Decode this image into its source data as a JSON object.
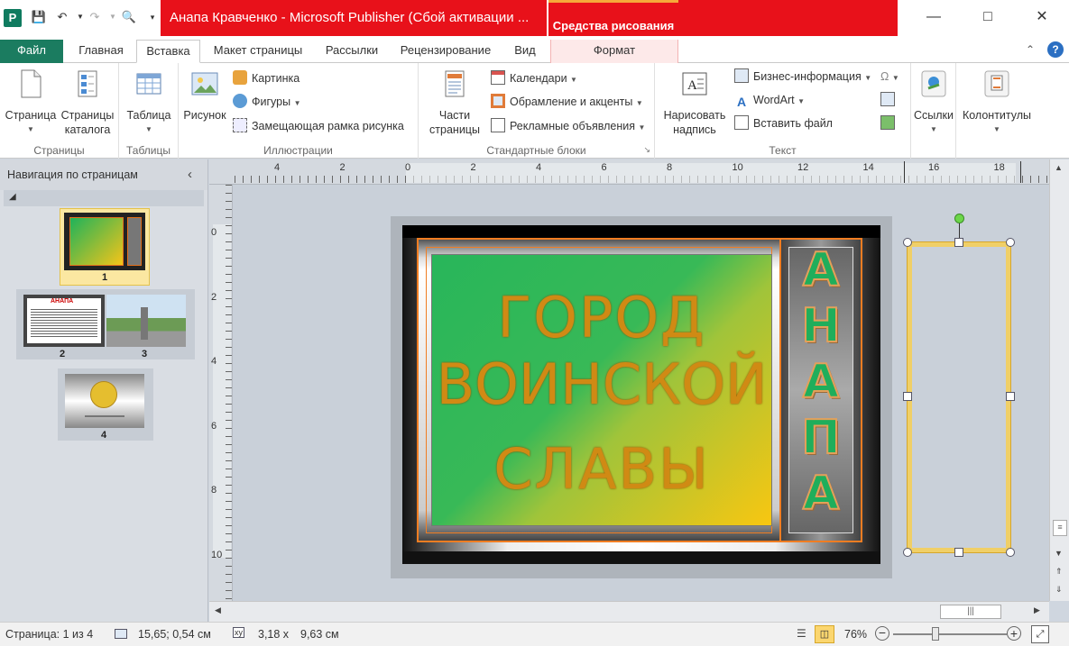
{
  "window": {
    "title": "Анапа Кравченко  -  Microsoft Publisher (Сбой активации ...",
    "context_tools": "Средства рисования",
    "app_icon": "publisher-icon"
  },
  "tabs": {
    "file": "Файл",
    "items": [
      "Главная",
      "Вставка",
      "Макет страницы",
      "Рассылки",
      "Рецензирование",
      "Вид"
    ],
    "context_tab": "Формат",
    "active": "Вставка"
  },
  "ribbon": {
    "pages": {
      "label": "Страницы",
      "page_btn": "Страница",
      "catalog_btn_1": "Страницы",
      "catalog_btn_2": "каталога"
    },
    "tables": {
      "label": "Таблицы",
      "table_btn": "Таблица"
    },
    "illustrations": {
      "label": "Иллюстрации",
      "picture_btn": "Рисунок",
      "clipart": "Картинка",
      "shapes": "Фигуры",
      "placeholder": "Замещающая рамка рисунка"
    },
    "blocks": {
      "label": "Стандартные блоки",
      "parts_1": "Части",
      "parts_2": "страницы",
      "calendars": "Календари",
      "borders": "Обрамление и акценты",
      "ads": "Рекламные объявления"
    },
    "text": {
      "label": "Текст",
      "draw_1": "Нарисовать",
      "draw_2": "надпись",
      "bizinfo": "Бизнес-информация",
      "wordart": "WordArt",
      "insertfile": "Вставить файл"
    },
    "links": {
      "label": "Ссылки"
    },
    "header": {
      "label": "Колонтитулы"
    }
  },
  "nav": {
    "title": "Навигация по страницам",
    "pages": [
      "1",
      "2",
      "3",
      "4"
    ],
    "thumb2_title": "АНАПА"
  },
  "ruler": {
    "top": [
      "4",
      "2",
      "0",
      "2",
      "4",
      "6",
      "8",
      "10",
      "12",
      "14",
      "16",
      "18"
    ],
    "left": [
      "0",
      "2",
      "4",
      "6",
      "8",
      "10"
    ]
  },
  "slide": {
    "main_lines": [
      "ГОРОД",
      "ВОИНСКОЙ",
      "СЛАВЫ"
    ],
    "side_letters": [
      "А",
      "Н",
      "А",
      "П",
      "А"
    ]
  },
  "status": {
    "page": "Страница: 1 из 4",
    "pos": "15,65; 0,54 см",
    "size_w": "3,18 x",
    "size_h": "9,63 см",
    "zoom": "76%"
  }
}
